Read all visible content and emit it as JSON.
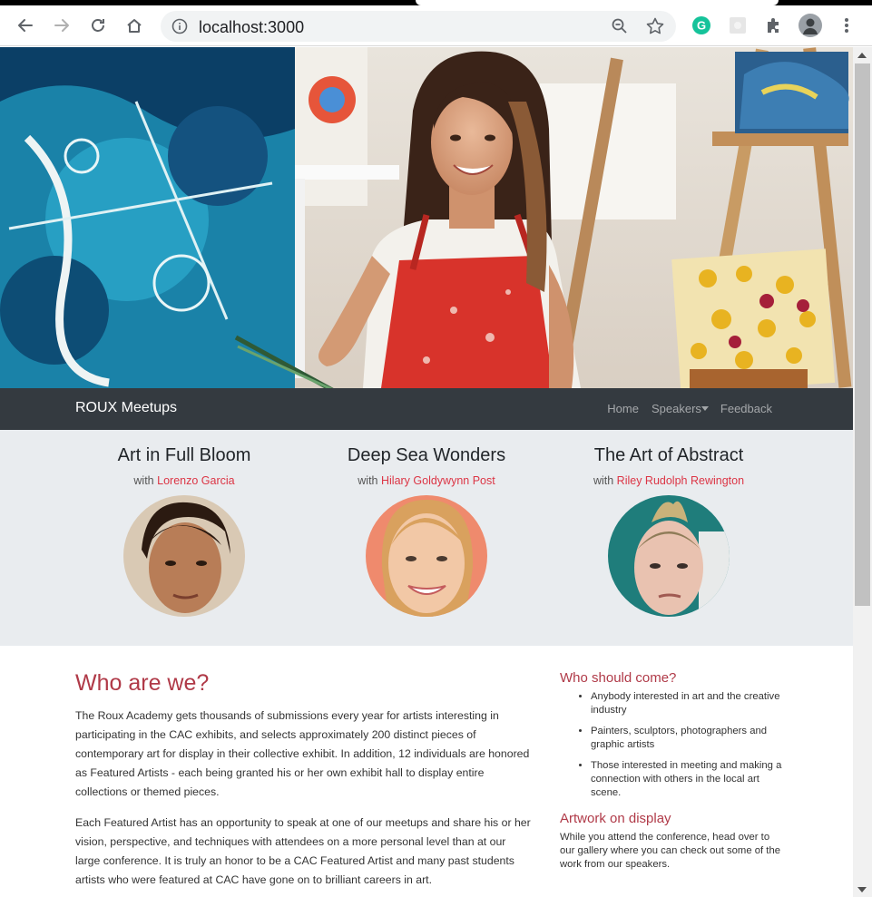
{
  "browser": {
    "url": "localhost:3000"
  },
  "navbar": {
    "brand": "ROUX Meetups",
    "links": {
      "home": "Home",
      "speakers": "Speakers",
      "feedback": "Feedback"
    }
  },
  "featured": [
    {
      "title": "Art in Full Bloom",
      "with": "with",
      "artist": "Lorenzo Garcia"
    },
    {
      "title": "Deep Sea Wonders",
      "with": "with",
      "artist": "Hilary Goldywynn Post"
    },
    {
      "title": "The Art of Abstract",
      "with": "with",
      "artist": "Riley Rudolph Rewington"
    }
  ],
  "about": {
    "heading": "Who are we?",
    "paragraphs": [
      "The Roux Academy gets thousands of submissions every year for artists interesting in participating in the CAC exhibits, and selects approximately 200 distinct pieces of contemporary art for display in their collective exhibit. In addition, 12 individuals are honored as Featured Artists - each being granted his or her own exhibit hall to display entire collections or themed pieces.",
      "Each Featured Artist has an opportunity to speak at one of our meetups and share his or her vision, perspective, and techniques with attendees on a more personal level than at our large conference. It is truly an honor to be a CAC Featured Artist and many past students artists who were featured at CAC have gone on to brilliant careers in art."
    ]
  },
  "sidebar": {
    "who_heading": "Who should come?",
    "who_items": [
      "Anybody interested in art and the creative industry",
      "Painters, sculptors, photographers and graphic artists",
      "Those interested in meeting and making a connection with others in the local art scene."
    ],
    "artwork_heading": "Artwork on display",
    "artwork_text": "While you attend the conference, head over to our gallery where you can check out some of the work from our speakers."
  },
  "colors": {
    "accent": "#b03a48",
    "link": "#dc3545",
    "navbar_bg": "#343a40",
    "jumbotron_bg": "#e9ecef"
  },
  "icons": [
    "back-arrow-icon",
    "forward-arrow-icon",
    "reload-icon",
    "home-icon",
    "info-icon",
    "zoom-out-icon",
    "star-icon",
    "grammarly-icon",
    "extension-icon",
    "puzzle-icon",
    "profile-avatar-icon",
    "kebab-menu-icon"
  ]
}
